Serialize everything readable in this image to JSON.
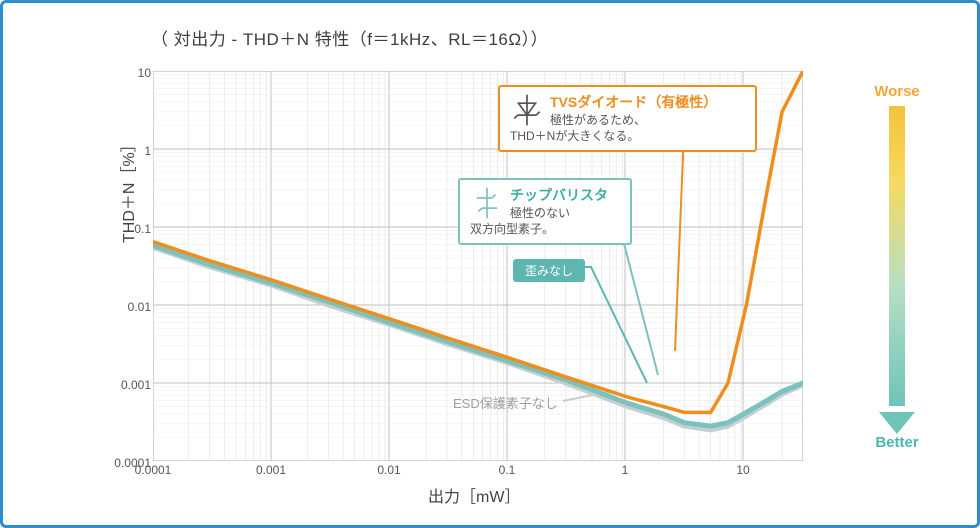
{
  "title": "（ 対出力 - THD＋N 特性（f＝1kHz、RL＝16Ω））",
  "axes": {
    "ylabel": "THD＋N［%］",
    "xlabel": "出力［mW］"
  },
  "ticks": {
    "y": [
      "10",
      "1",
      "0.1",
      "0.01",
      "0.001",
      "0.0001"
    ],
    "x": [
      "0.0001",
      "0.001",
      "0.01",
      "0.1",
      "1",
      "10"
    ]
  },
  "callouts": {
    "tvs": {
      "head": "TVSダイオード（有極性）",
      "body1": "極性があるため、",
      "body2": "THD＋Nが大きくなる。"
    },
    "var": {
      "head": "チップバリスタ",
      "body1": "極性のない",
      "body2": "双方向型素子。"
    }
  },
  "badge": "歪みなし",
  "esd_none": "ESD保護素子なし",
  "side": {
    "worse": "Worse",
    "better": "Better"
  },
  "chart_data": {
    "type": "line",
    "title": "対出力 - THD+N 特性 (f=1kHz, RL=16Ω)",
    "xlabel": "出力 [mW]",
    "ylabel": "THD+N [%]",
    "x_scale": "log",
    "y_scale": "log",
    "xlim": [
      0.0001,
      30
    ],
    "ylim": [
      0.0001,
      10
    ],
    "x": [
      0.0001,
      0.0003,
      0.001,
      0.003,
      0.01,
      0.03,
      0.1,
      0.3,
      1,
      2,
      3,
      5,
      7,
      10,
      15,
      20,
      30
    ],
    "series": [
      {
        "name": "TVSダイオード（有極性）",
        "color": "#ef8d1e",
        "values": [
          0.065,
          0.037,
          0.021,
          0.012,
          0.0066,
          0.0038,
          0.0021,
          0.0012,
          0.00066,
          0.0005,
          0.00042,
          0.00042,
          0.001,
          0.01,
          0.3,
          3.0,
          10
        ]
      },
      {
        "name": "チップバリスタ",
        "color": "#7bc2bd",
        "values": [
          0.058,
          0.033,
          0.019,
          0.011,
          0.0059,
          0.0034,
          0.0019,
          0.0011,
          0.00055,
          0.0004,
          0.00031,
          0.00028,
          0.00031,
          0.00042,
          0.0006,
          0.00078,
          0.001
        ]
      },
      {
        "name": "ESD保護素子なし",
        "color": "#c8cdd2",
        "values": [
          0.055,
          0.031,
          0.018,
          0.01,
          0.0056,
          0.0032,
          0.0018,
          0.001,
          0.0005,
          0.00036,
          0.00028,
          0.00025,
          0.00028,
          0.00038,
          0.00055,
          0.00072,
          0.00095
        ]
      }
    ]
  }
}
